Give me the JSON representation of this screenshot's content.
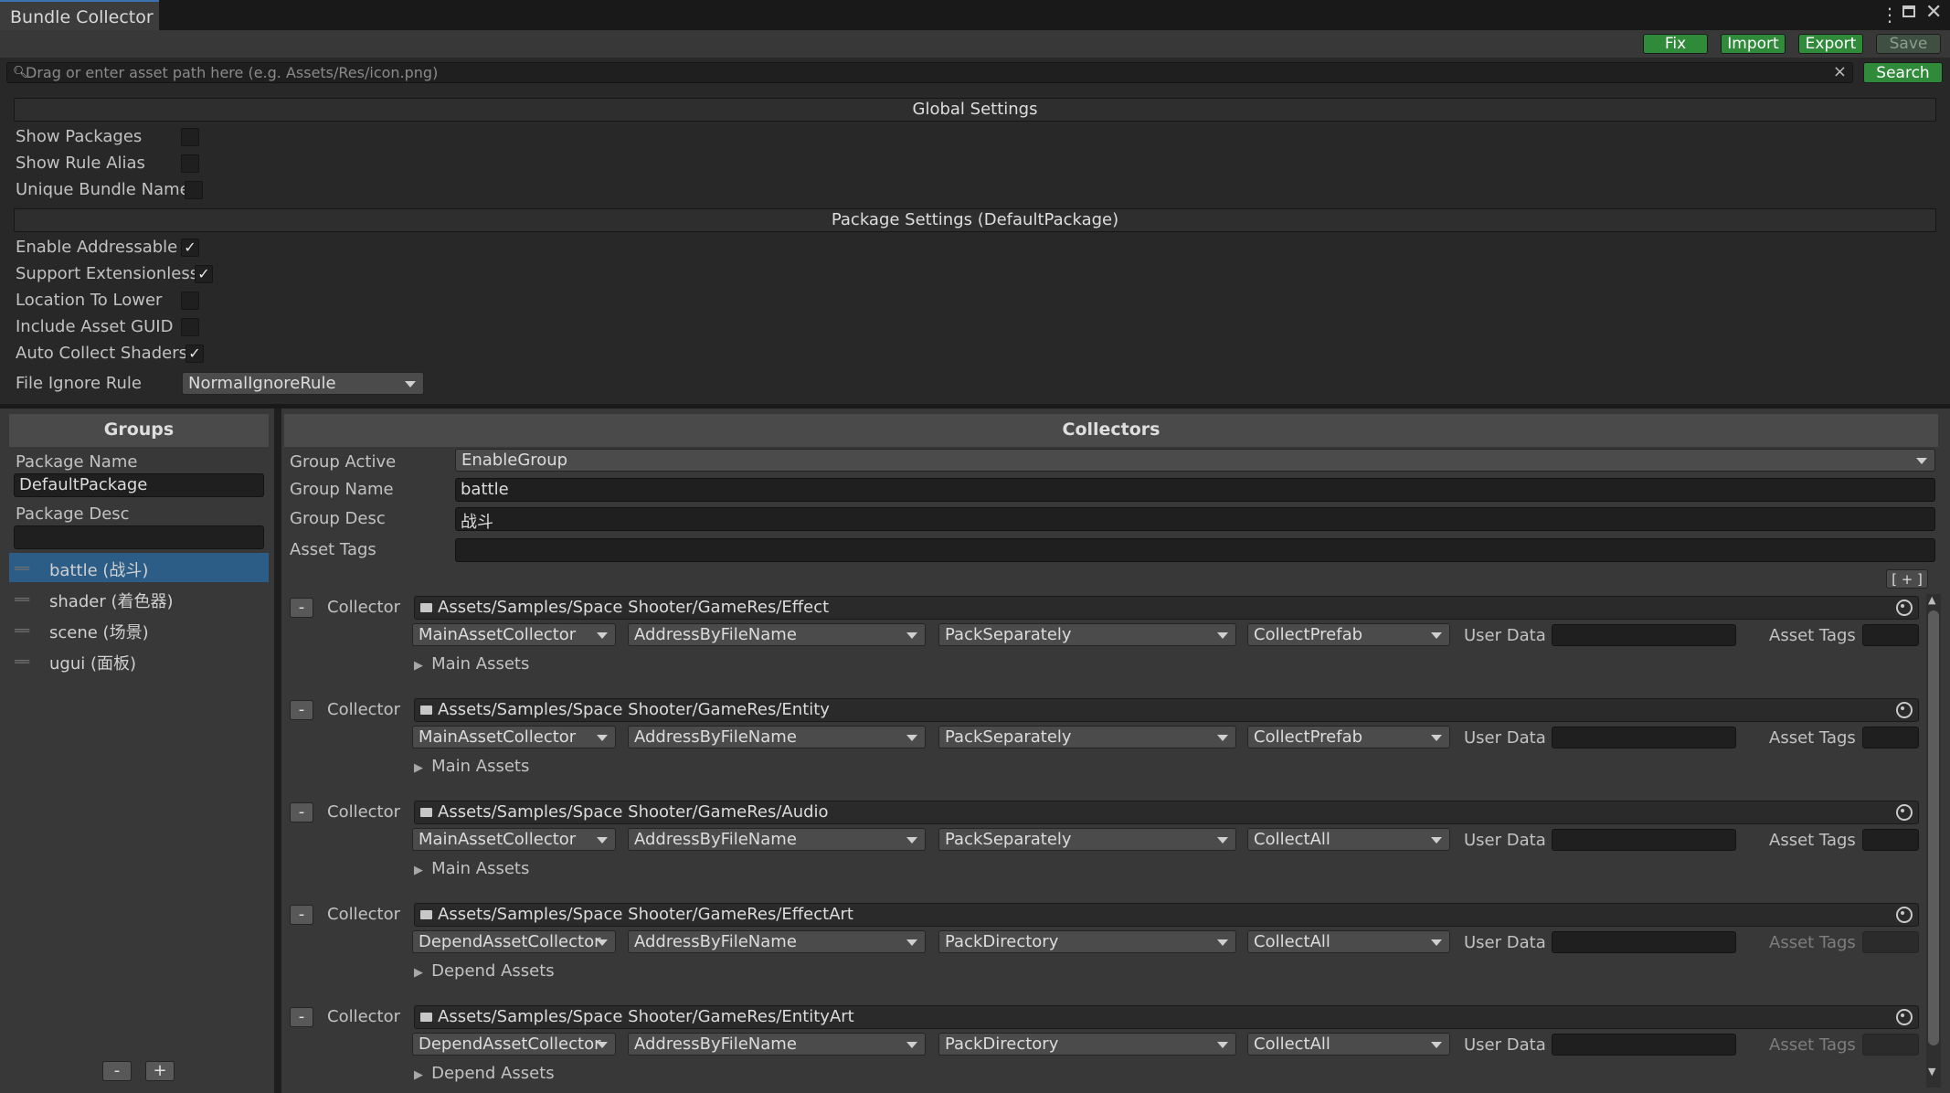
{
  "window": {
    "title": "Bundle Collector",
    "controls": [
      "more-icon",
      "maximize-icon",
      "close-icon"
    ]
  },
  "toolbar": {
    "fix_label": "Fix",
    "import_label": "Import",
    "export_label": "Export",
    "save_label": "Save"
  },
  "search": {
    "placeholder": "Drag or enter asset path here (e.g. Assets/Res/icon.png)",
    "clear_icon": "×",
    "button_label": "Search"
  },
  "global_settings": {
    "title": "Global Settings",
    "options": [
      {
        "label": "Show Packages",
        "checked": false
      },
      {
        "label": "Show Rule Alias",
        "checked": false
      },
      {
        "label": "Unique Bundle Name",
        "checked": false
      }
    ]
  },
  "package_settings": {
    "title": "Package Settings (DefaultPackage)",
    "options": [
      {
        "label": "Enable Addressable",
        "checked": true
      },
      {
        "label": "Support Extensionless",
        "checked": true
      },
      {
        "label": "Location To Lower",
        "checked": false
      },
      {
        "label": "Include Asset GUID",
        "checked": false
      },
      {
        "label": "Auto Collect Shaders",
        "checked": true
      }
    ],
    "file_ignore_rule_label": "File Ignore Rule",
    "file_ignore_rule_value": "NormalIgnoreRule"
  },
  "groups_panel": {
    "title": "Groups",
    "package_name_label": "Package Name",
    "package_name_value": "DefaultPackage",
    "package_desc_label": "Package Desc",
    "package_desc_value": "",
    "items": [
      {
        "label": "battle (战斗)",
        "selected": true
      },
      {
        "label": "shader (着色器)",
        "selected": false
      },
      {
        "label": "scene (场景)",
        "selected": false
      },
      {
        "label": "ugui (面板)",
        "selected": false
      }
    ],
    "remove_label": "-",
    "add_label": "+"
  },
  "collectors_panel": {
    "title": "Collectors",
    "group_active_label": "Group Active",
    "group_active_value": "EnableGroup",
    "group_name_label": "Group Name",
    "group_name_value": "battle",
    "group_desc_label": "Group Desc",
    "group_desc_value": "战斗",
    "asset_tags_label": "Asset Tags",
    "asset_tags_value": "",
    "add_collector_label": "[ + ]",
    "collector_label": "Collector",
    "remove_label": "-",
    "user_data_label": "User Data",
    "asset_tags_item_label": "Asset Tags",
    "collectors": [
      {
        "path": "Assets/Samples/Space Shooter/GameRes/Effect",
        "collector_type": "MainAssetCollector",
        "address_rule": "AddressByFileName",
        "pack_rule": "PackSeparately",
        "filter_rule": "CollectPrefab",
        "fold_label": "Main Assets"
      },
      {
        "path": "Assets/Samples/Space Shooter/GameRes/Entity",
        "collector_type": "MainAssetCollector",
        "address_rule": "AddressByFileName",
        "pack_rule": "PackSeparately",
        "filter_rule": "CollectPrefab",
        "fold_label": "Main Assets"
      },
      {
        "path": "Assets/Samples/Space Shooter/GameRes/Audio",
        "collector_type": "MainAssetCollector",
        "address_rule": "AddressByFileName",
        "pack_rule": "PackSeparately",
        "filter_rule": "CollectAll",
        "fold_label": "Main Assets"
      },
      {
        "path": "Assets/Samples/Space Shooter/GameRes/EffectArt",
        "collector_type": "DependAssetCollector",
        "address_rule": "AddressByFileName",
        "pack_rule": "PackDirectory",
        "filter_rule": "CollectAll",
        "fold_label": "Depend Assets"
      },
      {
        "path": "Assets/Samples/Space Shooter/GameRes/EntityArt",
        "collector_type": "DependAssetCollector",
        "address_rule": "AddressByFileName",
        "pack_rule": "PackDirectory",
        "filter_rule": "CollectAll",
        "fold_label": "Depend Assets"
      }
    ]
  },
  "colors": {
    "accent_green": "#2f8a3a",
    "selection_blue": "#2c5d87",
    "panel_bg": "#383838"
  }
}
